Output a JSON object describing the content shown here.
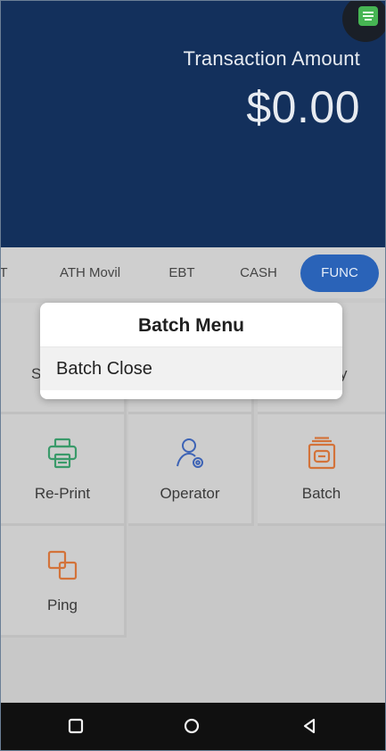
{
  "header": {
    "amount_label": "Transaction Amount",
    "amount_value": "$0.00",
    "status_icon": "terminal-status-icon"
  },
  "tabs": {
    "partial": "T",
    "items": [
      "ATH Movil",
      "EBT",
      "CASH",
      "FUNC"
    ],
    "active": "FUNC"
  },
  "grid": {
    "row0_left_partial": "S",
    "row0_right_partial": "y",
    "tiles": [
      {
        "label": "Re-Print",
        "icon": "printer-icon"
      },
      {
        "label": "Operator",
        "icon": "operator-icon"
      },
      {
        "label": "Batch",
        "icon": "batch-icon"
      },
      {
        "label": "Ping",
        "icon": "ping-icon"
      }
    ]
  },
  "dialog": {
    "title": "Batch Menu",
    "items": [
      "Batch Close"
    ]
  },
  "navbar": {
    "icons": [
      "recents-square-icon",
      "home-circle-icon",
      "back-triangle-icon"
    ]
  },
  "colors": {
    "header_bg": "#13305c",
    "accent": "#2a63b8",
    "printer": "#3a9a6a",
    "operator": "#3d63b5",
    "batch": "#d3733a"
  }
}
